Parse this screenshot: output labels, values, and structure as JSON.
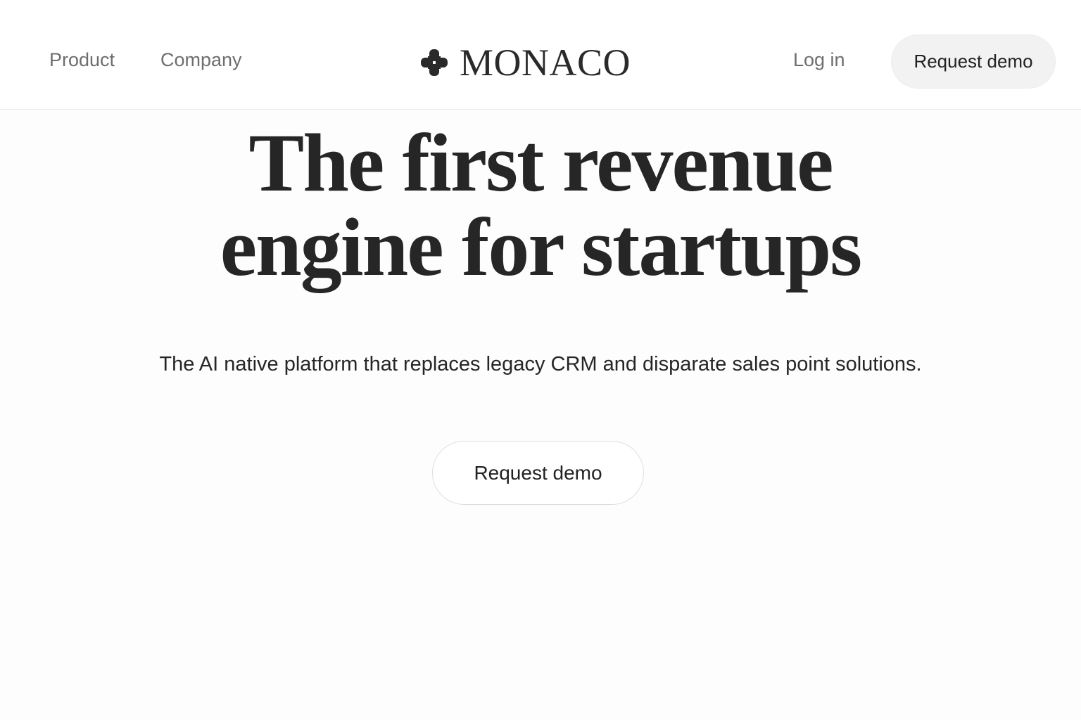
{
  "nav": {
    "product_label": "Product",
    "company_label": "Company",
    "login_label": "Log in",
    "request_demo_label": "Request demo"
  },
  "brand": {
    "name": "MONACO",
    "icon": "plus-blob-logo-icon"
  },
  "hero": {
    "headline_line1": "The first revenue",
    "headline_line2": "engine for startups",
    "subheadline": "The AI native platform that replaces legacy CRM and disparate sales point solutions.",
    "cta_label": "Request demo"
  },
  "colors": {
    "background": "#fdfdfd",
    "text": "#262626",
    "muted_nav": "#6e6e6e",
    "button_fill": "#f2f2f2"
  }
}
